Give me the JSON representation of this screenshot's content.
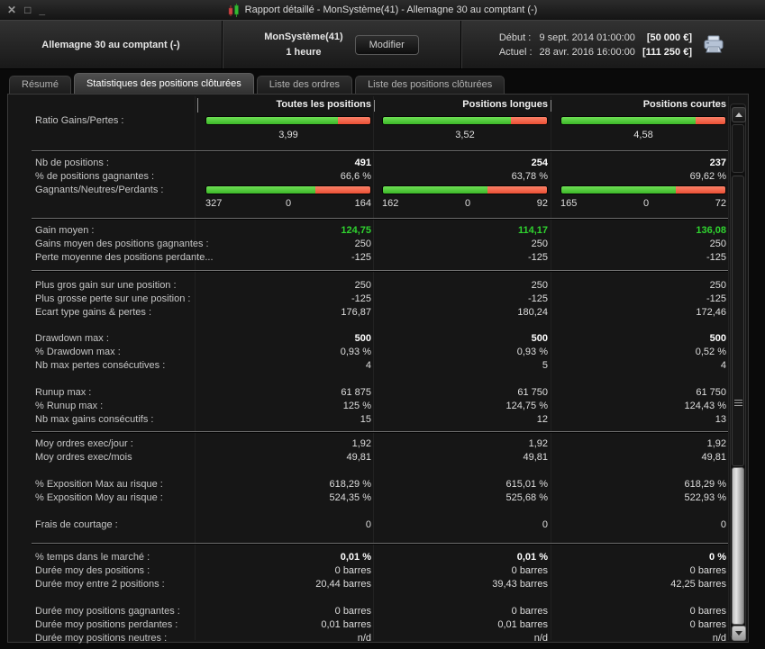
{
  "window": {
    "title": "Rapport détaillé - MonSystème(41) - Allemagne 30 au comptant (-)",
    "controls": {
      "close": "✕",
      "maximize": "□",
      "minimize": "_"
    }
  },
  "header": {
    "instrument": "Allemagne 30 au comptant (-)",
    "system_name": "MonSystème(41)",
    "timeframe": "1 heure",
    "modify_label": "Modifier",
    "start_label": "Début :",
    "start_value": "9 sept. 2014 01:00:00",
    "start_amount": "[50 000 €]",
    "current_label": "Actuel :",
    "current_value": "28 avr. 2016 16:00:00",
    "current_amount": "[111 250 €]"
  },
  "tabs": [
    {
      "label": "Résumé",
      "active": false
    },
    {
      "label": "Statistiques des positions clôturées",
      "active": true
    },
    {
      "label": "Liste des ordres",
      "active": false
    },
    {
      "label": "Liste des positions clôturées",
      "active": false
    }
  ],
  "colors": {
    "gain_green": "#2fd32f",
    "bar_green": "#4ecb38",
    "bar_red": "#f16a4e"
  },
  "table": {
    "columns": [
      "Toutes les positions",
      "Positions longues",
      "Positions courtes"
    ],
    "sections": [
      {
        "divider_after": true,
        "rows": [
          {
            "type": "ratio_bar",
            "label": "Ratio Gains/Pertes :",
            "values": [
              "3,99",
              "3,52",
              "4,58"
            ],
            "green_pct": [
              80,
              77.9,
              82.1
            ]
          }
        ]
      },
      {
        "divider_after": true,
        "rows": [
          {
            "type": "text",
            "label": "Nb de positions :",
            "values": [
              "491",
              "254",
              "237"
            ],
            "style": "bold"
          },
          {
            "type": "text",
            "label": "% de positions gagnantes :",
            "values": [
              "66,6 %",
              "63,78 %",
              "69,62 %"
            ],
            "style": "normal"
          },
          {
            "type": "split_bar",
            "label": "Gagnants/Neutres/Perdants :",
            "triplets": [
              [
                "327",
                "0",
                "164"
              ],
              [
                "162",
                "0",
                "92"
              ],
              [
                "165",
                "0",
                "72"
              ]
            ],
            "green_pct": [
              66.6,
              63.8,
              69.6
            ]
          }
        ]
      },
      {
        "divider_after": true,
        "rows": [
          {
            "type": "text",
            "label": "Gain moyen :",
            "values": [
              "124,75",
              "114,17",
              "136,08"
            ],
            "style": "green"
          },
          {
            "type": "text",
            "label": "Gains moyen des positions gagnantes :",
            "values": [
              "250",
              "250",
              "250"
            ],
            "style": "normal"
          },
          {
            "type": "text",
            "label": "Perte moyenne des positions perdante...",
            "values": [
              "-125",
              "-125",
              "-125"
            ],
            "style": "normal"
          }
        ]
      },
      {
        "divider_after": false,
        "rows": [
          {
            "type": "text",
            "label": "Plus gros gain sur une position :",
            "values": [
              "250",
              "250",
              "250"
            ],
            "style": "normal"
          },
          {
            "type": "text",
            "label": "Plus grosse perte sur une position :",
            "values": [
              "-125",
              "-125",
              "-125"
            ],
            "style": "normal"
          },
          {
            "type": "text",
            "label": "Ecart type gains & pertes :",
            "values": [
              "176,87",
              "180,24",
              "172,46"
            ],
            "style": "normal"
          }
        ]
      },
      {
        "divider_after": false,
        "rows": [
          {
            "type": "text",
            "label": "Drawdown max :",
            "values": [
              "500",
              "500",
              "500"
            ],
            "style": "bold"
          },
          {
            "type": "text",
            "label": "% Drawdown max :",
            "values": [
              "0,93 %",
              "0,93 %",
              "0,52 %"
            ],
            "style": "normal"
          },
          {
            "type": "text",
            "label": "Nb max pertes consécutives :",
            "values": [
              "4",
              "5",
              "4"
            ],
            "style": "normal"
          }
        ]
      },
      {
        "divider_after": true,
        "rows": [
          {
            "type": "text",
            "label": "Runup max :",
            "values": [
              "61 875",
              "61 750",
              "61 750"
            ],
            "style": "normal"
          },
          {
            "type": "text",
            "label": "% Runup max :",
            "values": [
              "125 %",
              "124,75 %",
              "124,43 %"
            ],
            "style": "normal"
          },
          {
            "type": "text",
            "label": "Nb max gains consécutifs :",
            "values": [
              "15",
              "12",
              "13"
            ],
            "style": "normal"
          }
        ]
      },
      {
        "divider_after": false,
        "rows": [
          {
            "type": "text",
            "label": "Moy ordres exec/jour :",
            "values": [
              "1,92",
              "1,92",
              "1,92"
            ],
            "style": "normal"
          },
          {
            "type": "text",
            "label": "Moy ordres exec/mois",
            "values": [
              "49,81",
              "49,81",
              "49,81"
            ],
            "style": "normal"
          }
        ]
      },
      {
        "divider_after": false,
        "rows": [
          {
            "type": "text",
            "label": "% Exposition Max au risque :",
            "values": [
              "618,29 %",
              "615,01 %",
              "618,29 %"
            ],
            "style": "normal"
          },
          {
            "type": "text",
            "label": "% Exposition Moy au risque :",
            "values": [
              "524,35 %",
              "525,68 %",
              "522,93 %"
            ],
            "style": "normal"
          }
        ]
      },
      {
        "divider_after": true,
        "rows": [
          {
            "type": "text",
            "label": "Frais de courtage :",
            "values": [
              "0",
              "0",
              "0"
            ],
            "style": "normal"
          }
        ]
      },
      {
        "divider_after": false,
        "rows": [
          {
            "type": "text",
            "label": "% temps dans le marché :",
            "values": [
              "0,01 %",
              "0,01 %",
              "0 %"
            ],
            "style": "bold"
          },
          {
            "type": "text",
            "label": "Durée moy des positions :",
            "values": [
              "0 barres",
              "0 barres",
              "0 barres"
            ],
            "style": "normal"
          },
          {
            "type": "text",
            "label": "Durée moy entre 2 positions :",
            "values": [
              "20,44 barres",
              "39,43 barres",
              "42,25 barres"
            ],
            "style": "normal"
          }
        ]
      },
      {
        "divider_after": false,
        "rows": [
          {
            "type": "text",
            "label": "Durée moy positions gagnantes :",
            "values": [
              "0 barres",
              "0 barres",
              "0 barres"
            ],
            "style": "normal"
          },
          {
            "type": "text",
            "label": "Durée moy positions perdantes :",
            "values": [
              "0,01 barres",
              "0,01 barres",
              "0 barres"
            ],
            "style": "normal"
          },
          {
            "type": "text",
            "label": "Durée moy positions neutres :",
            "values": [
              "n/d",
              "n/d",
              "n/d"
            ],
            "style": "normal"
          }
        ]
      }
    ]
  }
}
